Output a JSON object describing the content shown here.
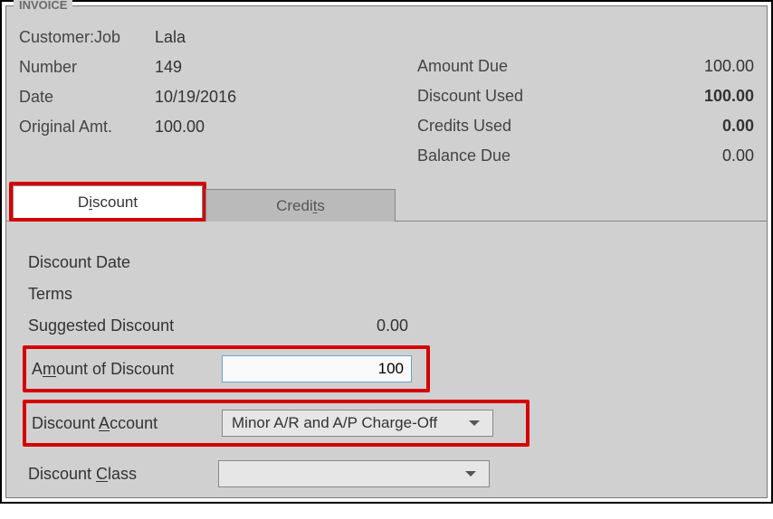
{
  "panel_title": "INVOICE",
  "left": {
    "customer_job_label": "Customer:Job",
    "customer_job_value": "Lala",
    "number_label": "Number",
    "number_value": "149",
    "date_label": "Date",
    "date_value": "10/19/2016",
    "orig_amt_label": "Original Amt.",
    "orig_amt_value": "100.00"
  },
  "right": {
    "amount_due_label": "Amount Due",
    "amount_due_value": "100.00",
    "discount_used_label": "Discount Used",
    "discount_used_value": "100.00",
    "credits_used_label": "Credits Used",
    "credits_used_value": "0.00",
    "balance_due_label": "Balance Due",
    "balance_due_value": "0.00"
  },
  "tabs": {
    "discount_pre": "D",
    "discount_u": "i",
    "discount_post": "scount",
    "credits_pre": "Credi",
    "credits_u": "t",
    "credits_post": "s"
  },
  "form": {
    "discount_date_label": "Discount Date",
    "terms_label": "Terms",
    "suggested_discount_label": "Suggested Discount",
    "suggested_discount_value": "0.00",
    "amount_of_discount_pre": "A",
    "amount_of_discount_u": "m",
    "amount_of_discount_post": "ount of Discount",
    "amount_of_discount_value": "100",
    "discount_account_pre": "Discount ",
    "discount_account_u": "A",
    "discount_account_post": "ccount",
    "discount_account_value": "Minor A/R and A/P Charge-Off",
    "discount_class_pre": "Discount ",
    "discount_class_u": "C",
    "discount_class_post": "lass",
    "discount_class_value": ""
  }
}
